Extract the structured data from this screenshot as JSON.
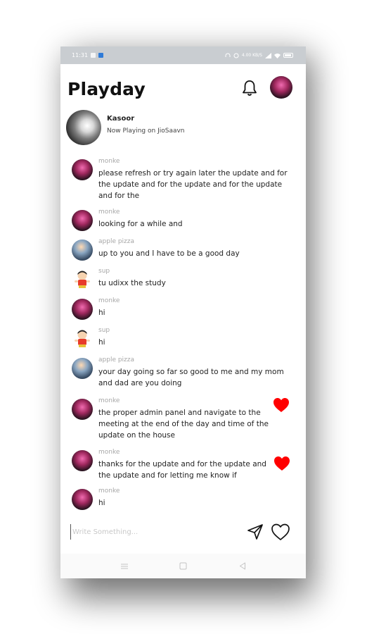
{
  "status_bar": {
    "time": "11:31",
    "right_text": "4.00 KB/S"
  },
  "header": {
    "app_title": "Playday",
    "icons": [
      "bell-icon",
      "profile-avatar"
    ]
  },
  "now_playing": {
    "title": "Kasoor",
    "subtitle": "Now Playing on JioSaavn"
  },
  "messages": [
    {
      "user": "monke",
      "avatar": "pink",
      "text": "please refresh or try again later the update and for the update and for the update and for the update and for the",
      "liked": false
    },
    {
      "user": "monke",
      "avatar": "pink",
      "text": "looking for a while and",
      "liked": false
    },
    {
      "user": "apple pizza",
      "avatar": "blue",
      "text": "up to you and I have to be a good day",
      "liked": false
    },
    {
      "user": "sup",
      "avatar": "cartoon",
      "text": "tu udixx the study",
      "liked": false
    },
    {
      "user": "monke",
      "avatar": "pink",
      "text": "hi",
      "liked": false
    },
    {
      "user": "sup",
      "avatar": "cartoon",
      "text": "hi",
      "liked": false
    },
    {
      "user": "apple pizza",
      "avatar": "blue",
      "text": "your day going so far so good to me and my mom and dad are you doing",
      "liked": false
    },
    {
      "user": "monke",
      "avatar": "pink",
      "text": "the proper admin panel and navigate to the meeting at the end of the day and time of the update on the house",
      "liked": true
    },
    {
      "user": "monke",
      "avatar": "pink",
      "text": "thanks for the update and for the update and the update and for letting me know if",
      "liked": true
    },
    {
      "user": "monke",
      "avatar": "pink",
      "text": "hi",
      "liked": false
    }
  ],
  "composer": {
    "placeholder": "Write Something...",
    "send_icon": "send-icon",
    "like_icon": "heart-outline-icon"
  },
  "nav_bar": [
    "menu-icon",
    "home-square-icon",
    "back-triangle-icon"
  ],
  "colors": {
    "status_bar": "#c9cdd1",
    "heart": "#ff0000",
    "username": "#a7a7a7",
    "text": "#222222"
  }
}
